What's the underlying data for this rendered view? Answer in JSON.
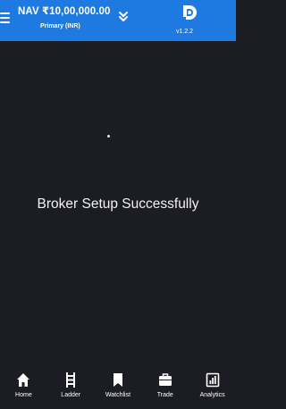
{
  "header": {
    "nav_value": "NAV ₹10,00,000.00",
    "account": "Primary (INR)",
    "version": "v1.2.2",
    "menu_icon": "hamburger-menu-icon",
    "expand_icon": "double-chevron-down-icon",
    "logo_icon": "app-logo-icon"
  },
  "main": {
    "message": "Broker Setup Successfully"
  },
  "bottom_nav": {
    "items": [
      {
        "label": "Home",
        "icon": "home-icon"
      },
      {
        "label": "Ladder",
        "icon": "ladder-icon"
      },
      {
        "label": "Watchlist",
        "icon": "bookmark-icon"
      },
      {
        "label": "Trade",
        "icon": "briefcase-icon"
      },
      {
        "label": "Analytics",
        "icon": "analytics-icon"
      }
    ]
  },
  "colors": {
    "header_bg": "#1e7ae0",
    "screen_bg": "#1c1d24",
    "text": "#ffffff"
  }
}
